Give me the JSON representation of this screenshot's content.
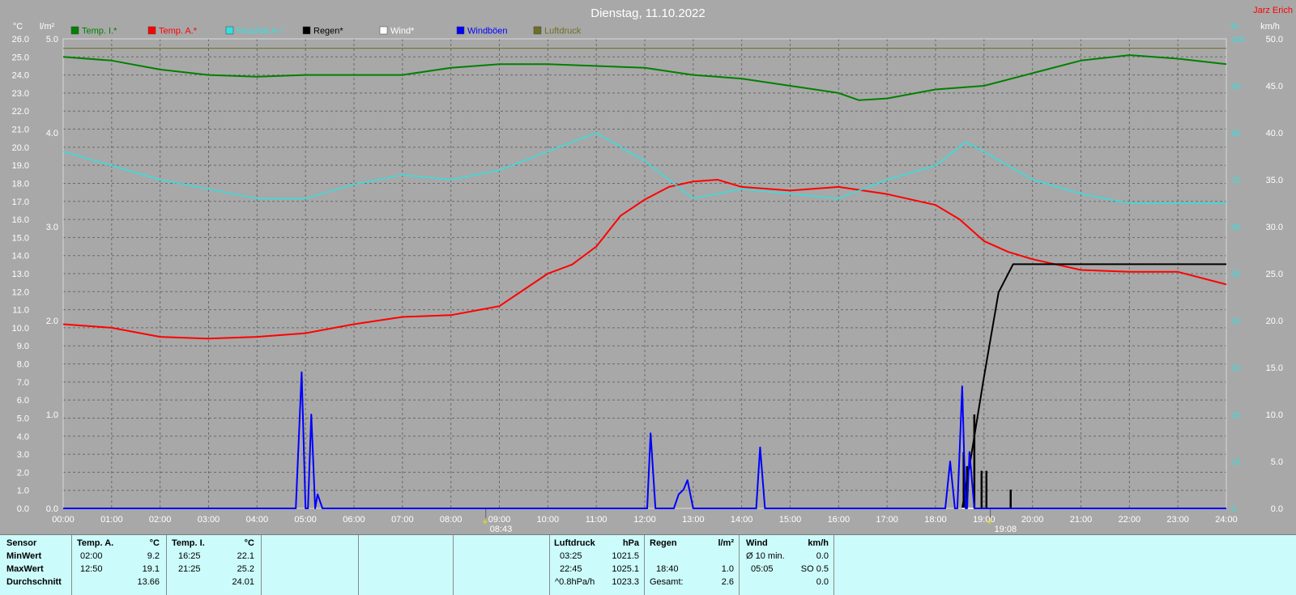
{
  "header": {
    "title": "Dienstag, 11.10.2022",
    "author": "Jarz Erich"
  },
  "colors": {
    "temp_i": "#008000",
    "temp_a": "#ff0000",
    "feuchte": "#33e0e0",
    "regen": "#000000",
    "wind": "#ffffff",
    "windboeen": "#0000ff",
    "luftdruck": "#6e6e28",
    "bg": "#a8a8a8"
  },
  "chart_data": {
    "type": "line",
    "title": "Dienstag, 11.10.2022",
    "axes": {
      "left_temp": {
        "unit": "°C",
        "min": 0,
        "max": 26,
        "ticks": [
          "26.0",
          "25.0",
          "24.0",
          "23.0",
          "22.0",
          "21.0",
          "20.0",
          "19.0",
          "18.0",
          "17.0",
          "16.0",
          "15.0",
          "14.0",
          "13.0",
          "12.0",
          "11.0",
          "10.0",
          "9.0",
          "8.0",
          "7.0",
          "6.0",
          "5.0",
          "4.0",
          "3.0",
          "2.0",
          "1.0",
          "0.0"
        ]
      },
      "left_rain": {
        "unit": "l/m²",
        "min": 0,
        "max": 5,
        "ticks": [
          "5.0",
          "4.0",
          "3.0",
          "2.0",
          "1.0",
          "0.0"
        ]
      },
      "right_humidity": {
        "unit": "%",
        "min": 0,
        "max": 100,
        "ticks": [
          "100",
          "90",
          "80",
          "70",
          "60",
          "50",
          "40",
          "30",
          "20",
          "10",
          "0"
        ]
      },
      "right_wind": {
        "unit": "km/h",
        "min": 0,
        "max": 50,
        "ticks": [
          "50.0",
          "45.0",
          "40.0",
          "35.0",
          "30.0",
          "25.0",
          "20.0",
          "15.0",
          "10.0",
          "5.0",
          "0.0"
        ]
      },
      "x": {
        "min": 0,
        "max": 24,
        "ticks": [
          "00:00",
          "01:00",
          "02:00",
          "03:00",
          "04:00",
          "05:00",
          "06:00",
          "07:00",
          "08:00",
          "09:00",
          "10:00",
          "11:00",
          "12:00",
          "13:00",
          "14:00",
          "15:00",
          "16:00",
          "17:00",
          "18:00",
          "19:00",
          "20:00",
          "21:00",
          "22:00",
          "23:00",
          "24:00"
        ]
      }
    },
    "grid": true,
    "legend": "top",
    "markers": [
      {
        "label": "08:43",
        "x": 8.72
      },
      {
        "label": "19:08",
        "x": 19.13
      }
    ],
    "series": [
      {
        "name": "Temp. I.*",
        "axis": "left_temp",
        "color": "#008000",
        "points": [
          [
            0,
            25.0
          ],
          [
            1,
            24.8
          ],
          [
            2,
            24.3
          ],
          [
            3,
            24.0
          ],
          [
            4,
            23.9
          ],
          [
            5,
            24.0
          ],
          [
            6,
            24.0
          ],
          [
            7,
            24.0
          ],
          [
            8,
            24.4
          ],
          [
            9,
            24.6
          ],
          [
            10,
            24.6
          ],
          [
            11,
            24.5
          ],
          [
            12,
            24.4
          ],
          [
            13,
            24.0
          ],
          [
            14,
            23.8
          ],
          [
            15,
            23.4
          ],
          [
            16,
            23.0
          ],
          [
            16.42,
            22.6
          ],
          [
            17,
            22.7
          ],
          [
            18,
            23.2
          ],
          [
            19,
            23.4
          ],
          [
            20,
            24.1
          ],
          [
            21,
            24.8
          ],
          [
            22,
            25.1
          ],
          [
            23,
            24.9
          ],
          [
            24,
            24.6
          ]
        ]
      },
      {
        "name": "Temp. A.*",
        "axis": "left_temp",
        "color": "#ff0000",
        "points": [
          [
            0,
            10.2
          ],
          [
            1,
            10.0
          ],
          [
            2,
            9.5
          ],
          [
            3,
            9.4
          ],
          [
            4,
            9.5
          ],
          [
            5,
            9.7
          ],
          [
            6,
            10.2
          ],
          [
            7,
            10.6
          ],
          [
            8,
            10.7
          ],
          [
            9,
            11.2
          ],
          [
            10,
            13.0
          ],
          [
            10.5,
            13.5
          ],
          [
            11,
            14.5
          ],
          [
            11.5,
            16.2
          ],
          [
            12,
            17.1
          ],
          [
            12.5,
            17.8
          ],
          [
            13,
            18.1
          ],
          [
            13.5,
            18.2
          ],
          [
            14,
            17.8
          ],
          [
            15,
            17.6
          ],
          [
            16,
            17.8
          ],
          [
            17,
            17.4
          ],
          [
            18,
            16.8
          ],
          [
            18.5,
            16.0
          ],
          [
            19,
            14.8
          ],
          [
            19.5,
            14.2
          ],
          [
            20,
            13.8
          ],
          [
            21,
            13.2
          ],
          [
            22,
            13.1
          ],
          [
            23,
            13.1
          ],
          [
            24,
            12.4
          ]
        ]
      },
      {
        "name": "Feuchte A.*",
        "axis": "right_humidity",
        "color": "#33e0e0",
        "points": [
          [
            0,
            76
          ],
          [
            1,
            73
          ],
          [
            2,
            70
          ],
          [
            3,
            68
          ],
          [
            4,
            66
          ],
          [
            5,
            66
          ],
          [
            6,
            69
          ],
          [
            7,
            71
          ],
          [
            8,
            70
          ],
          [
            9,
            72
          ],
          [
            10,
            76
          ],
          [
            11,
            80
          ],
          [
            12,
            74
          ],
          [
            13,
            66
          ],
          [
            14,
            68
          ],
          [
            15,
            67
          ],
          [
            16,
            66
          ],
          [
            17,
            70
          ],
          [
            18,
            73
          ],
          [
            18.62,
            78
          ],
          [
            19,
            76
          ],
          [
            20,
            70
          ],
          [
            21,
            67
          ],
          [
            22,
            65
          ],
          [
            23,
            65
          ],
          [
            24,
            65
          ]
        ]
      },
      {
        "name": "Regen*",
        "axis": "left_rain",
        "color": "#000000",
        "points": [
          [
            0,
            0
          ],
          [
            18.55,
            0
          ],
          [
            18.7,
            0.45
          ],
          [
            19,
            1.4
          ],
          [
            19.3,
            2.3
          ],
          [
            19.6,
            2.6
          ],
          [
            20,
            2.6
          ],
          [
            24,
            2.6
          ]
        ]
      },
      {
        "name": "Wind*",
        "axis": "right_wind",
        "color": "#ffffff",
        "points": [
          [
            0,
            0
          ],
          [
            24,
            0
          ]
        ]
      },
      {
        "name": "Windböen",
        "axis": "right_wind",
        "color": "#0000ff",
        "points": [
          [
            0,
            0
          ],
          [
            4.8,
            0
          ],
          [
            4.92,
            14.5
          ],
          [
            5.0,
            0
          ],
          [
            5.05,
            0
          ],
          [
            5.12,
            10
          ],
          [
            5.2,
            0
          ],
          [
            5.25,
            1.5
          ],
          [
            5.35,
            0
          ],
          [
            12.05,
            0
          ],
          [
            12.12,
            8
          ],
          [
            12.22,
            0
          ],
          [
            12.6,
            0
          ],
          [
            12.7,
            1.5
          ],
          [
            12.8,
            2
          ],
          [
            12.88,
            3
          ],
          [
            13.0,
            0
          ],
          [
            14.3,
            0
          ],
          [
            14.38,
            6.5
          ],
          [
            14.48,
            0
          ],
          [
            18.2,
            0
          ],
          [
            18.3,
            5
          ],
          [
            18.4,
            0
          ],
          [
            18.45,
            0
          ],
          [
            18.55,
            13
          ],
          [
            18.62,
            0
          ],
          [
            18.65,
            0
          ],
          [
            18.7,
            6
          ],
          [
            18.8,
            0
          ],
          [
            24,
            0
          ]
        ]
      },
      {
        "name": "Luftdruck",
        "axis": "right_humidity",
        "color": "#6e6e28",
        "points": [
          [
            0,
            98
          ],
          [
            24,
            98
          ]
        ]
      }
    ],
    "rain_bars": [
      {
        "x": 18.58,
        "v": 0.6
      },
      {
        "x": 18.65,
        "v": 0.45
      },
      {
        "x": 18.8,
        "v": 1.0
      },
      {
        "x": 18.95,
        "v": 0.4
      },
      {
        "x": 19.05,
        "v": 0.4
      },
      {
        "x": 19.55,
        "v": 0.2
      }
    ]
  },
  "stats": {
    "sensor": {
      "label": "Sensor",
      "rows": [
        "MinWert",
        "MaxWert",
        "Durchschnitt"
      ]
    },
    "temp_a": {
      "title": "Temp. A.",
      "unit": "°C",
      "min_time": "02:00",
      "min_val": "9.2",
      "max_time": "12:50",
      "max_val": "19.1",
      "avg": "13.66"
    },
    "temp_i": {
      "title": "Temp. I.",
      "unit": "°C",
      "min_time": "16:25",
      "min_val": "22.1",
      "max_time": "21:25",
      "max_val": "25.2",
      "avg": "24.01"
    },
    "luftdruck": {
      "title": "Luftdruck",
      "unit": "hPa",
      "r1_time": "03:25",
      "r1_val": "1021.5",
      "r2_time": "22:45",
      "r2_val": "1025.1",
      "r3_time": "^0.8hPa/h",
      "r3_val": "1023.3"
    },
    "regen": {
      "title": "Regen",
      "unit": "l/m²",
      "r2_time": "18:40",
      "r2_val": "1.0",
      "r3_label": "Gesamt:",
      "r3_val": "2.6"
    },
    "wind": {
      "title": "Wind",
      "unit": "km/h",
      "r1_label": "Ø 10 min.",
      "r1_val": "0.0",
      "r2_time": "05:05",
      "r2_val": "SO 0.5",
      "r3_val": "0.0"
    }
  }
}
